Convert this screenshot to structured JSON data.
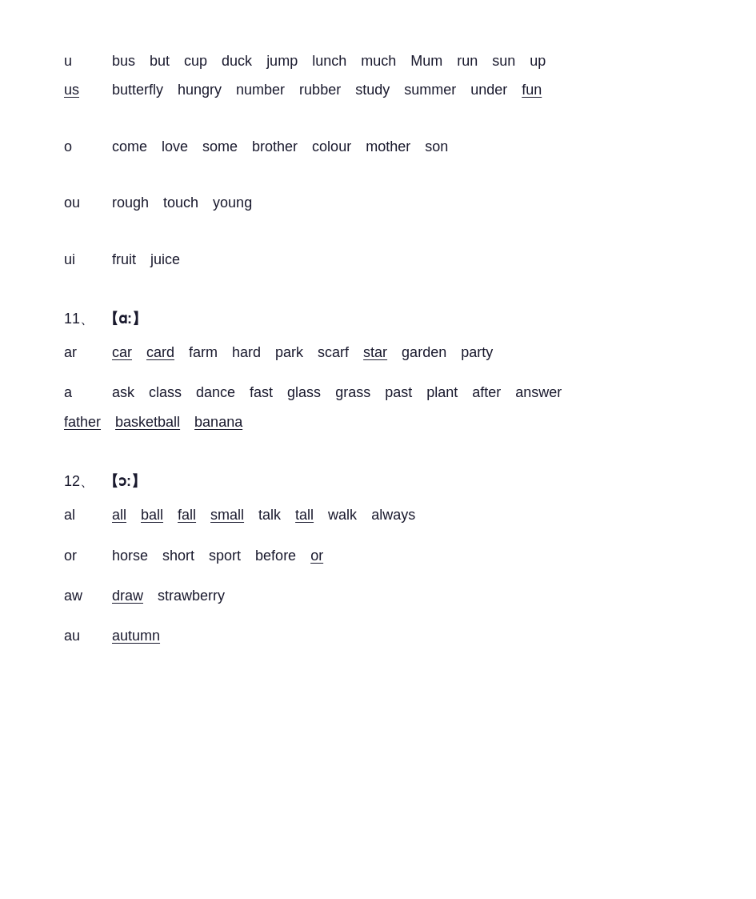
{
  "sections": [
    {
      "id": "u-section",
      "lines": [
        {
          "label": "u",
          "words": [
            {
              "text": "bus",
              "underline": false
            },
            {
              "text": "but",
              "underline": false
            },
            {
              "text": "cup",
              "underline": false
            },
            {
              "text": "duck",
              "underline": false
            },
            {
              "text": "jump",
              "underline": false
            },
            {
              "text": "lunch",
              "underline": false
            },
            {
              "text": "much",
              "underline": false
            },
            {
              "text": "Mum",
              "underline": false
            },
            {
              "text": "run",
              "underline": false
            },
            {
              "text": "sun",
              "underline": false
            },
            {
              "text": "up",
              "underline": false
            }
          ]
        },
        {
          "label": "us",
          "label_underline": true,
          "continuation": true,
          "words": [
            {
              "text": "butterfly",
              "underline": false
            },
            {
              "text": "hungry",
              "underline": false
            },
            {
              "text": "number",
              "underline": false
            },
            {
              "text": "rubber",
              "underline": false
            },
            {
              "text": "study",
              "underline": false
            },
            {
              "text": "summer",
              "underline": false
            },
            {
              "text": "under",
              "underline": false
            },
            {
              "text": "fun",
              "underline": true
            }
          ]
        }
      ]
    },
    {
      "id": "o-section",
      "lines": [
        {
          "label": "o",
          "words": [
            {
              "text": "come",
              "underline": false
            },
            {
              "text": "love",
              "underline": false
            },
            {
              "text": "some",
              "underline": false
            },
            {
              "text": "brother",
              "underline": false
            },
            {
              "text": "colour",
              "underline": false
            },
            {
              "text": "mother",
              "underline": false
            },
            {
              "text": "son",
              "underline": false
            }
          ]
        }
      ]
    },
    {
      "id": "ou-section",
      "lines": [
        {
          "label": "ou",
          "words": [
            {
              "text": "rough",
              "underline": false
            },
            {
              "text": "touch",
              "underline": false
            },
            {
              "text": "young",
              "underline": false
            }
          ]
        }
      ]
    },
    {
      "id": "ui-section",
      "lines": [
        {
          "label": "ui",
          "words": [
            {
              "text": "fruit",
              "underline": false
            },
            {
              "text": "juice",
              "underline": false
            }
          ]
        }
      ]
    },
    {
      "id": "section11",
      "number": "11、",
      "phoneme": "【ɑ:】",
      "subsections": [
        {
          "label": "ar",
          "lines": [
            {
              "words": [
                {
                  "text": "car",
                  "underline": true
                },
                {
                  "text": "card",
                  "underline": true
                },
                {
                  "text": "farm",
                  "underline": false
                },
                {
                  "text": "hard",
                  "underline": false
                },
                {
                  "text": "park",
                  "underline": false
                },
                {
                  "text": "scarf",
                  "underline": false
                },
                {
                  "text": "star",
                  "underline": true
                },
                {
                  "text": "garden",
                  "underline": false
                },
                {
                  "text": "party",
                  "underline": false
                }
              ]
            }
          ]
        },
        {
          "label": "a",
          "lines": [
            {
              "words": [
                {
                  "text": "ask",
                  "underline": false
                },
                {
                  "text": "class",
                  "underline": false
                },
                {
                  "text": "dance",
                  "underline": false
                },
                {
                  "text": "fast",
                  "underline": false
                },
                {
                  "text": "glass",
                  "underline": false
                },
                {
                  "text": "grass",
                  "underline": false
                },
                {
                  "text": "past",
                  "underline": false
                },
                {
                  "text": "plant",
                  "underline": false
                },
                {
                  "text": "after",
                  "underline": false
                },
                {
                  "text": "answer",
                  "underline": false
                }
              ]
            },
            {
              "continuation": true,
              "words": [
                {
                  "text": "father",
                  "underline": true
                },
                {
                  "text": "basketball",
                  "underline": true
                },
                {
                  "text": "banana",
                  "underline": true
                }
              ]
            }
          ]
        }
      ]
    },
    {
      "id": "section12",
      "number": "12、",
      "phoneme": "【ɔ:】",
      "subsections": [
        {
          "label": "al",
          "lines": [
            {
              "words": [
                {
                  "text": "all",
                  "underline": true
                },
                {
                  "text": "ball",
                  "underline": true
                },
                {
                  "text": "fall",
                  "underline": true
                },
                {
                  "text": "small",
                  "underline": true
                },
                {
                  "text": "talk",
                  "underline": false
                },
                {
                  "text": "tall",
                  "underline": true
                },
                {
                  "text": "walk",
                  "underline": false
                },
                {
                  "text": "always",
                  "underline": false
                }
              ]
            }
          ]
        },
        {
          "label": "or",
          "lines": [
            {
              "words": [
                {
                  "text": "horse",
                  "underline": false
                },
                {
                  "text": "short",
                  "underline": false
                },
                {
                  "text": "sport",
                  "underline": false
                },
                {
                  "text": "before",
                  "underline": false
                },
                {
                  "text": "or",
                  "underline": true
                }
              ]
            }
          ]
        },
        {
          "label": "aw",
          "lines": [
            {
              "words": [
                {
                  "text": "draw",
                  "underline": true
                },
                {
                  "text": "strawberry",
                  "underline": false
                }
              ]
            }
          ]
        },
        {
          "label": "au",
          "lines": [
            {
              "words": [
                {
                  "text": "autumn",
                  "underline": true
                }
              ]
            }
          ]
        }
      ]
    }
  ]
}
